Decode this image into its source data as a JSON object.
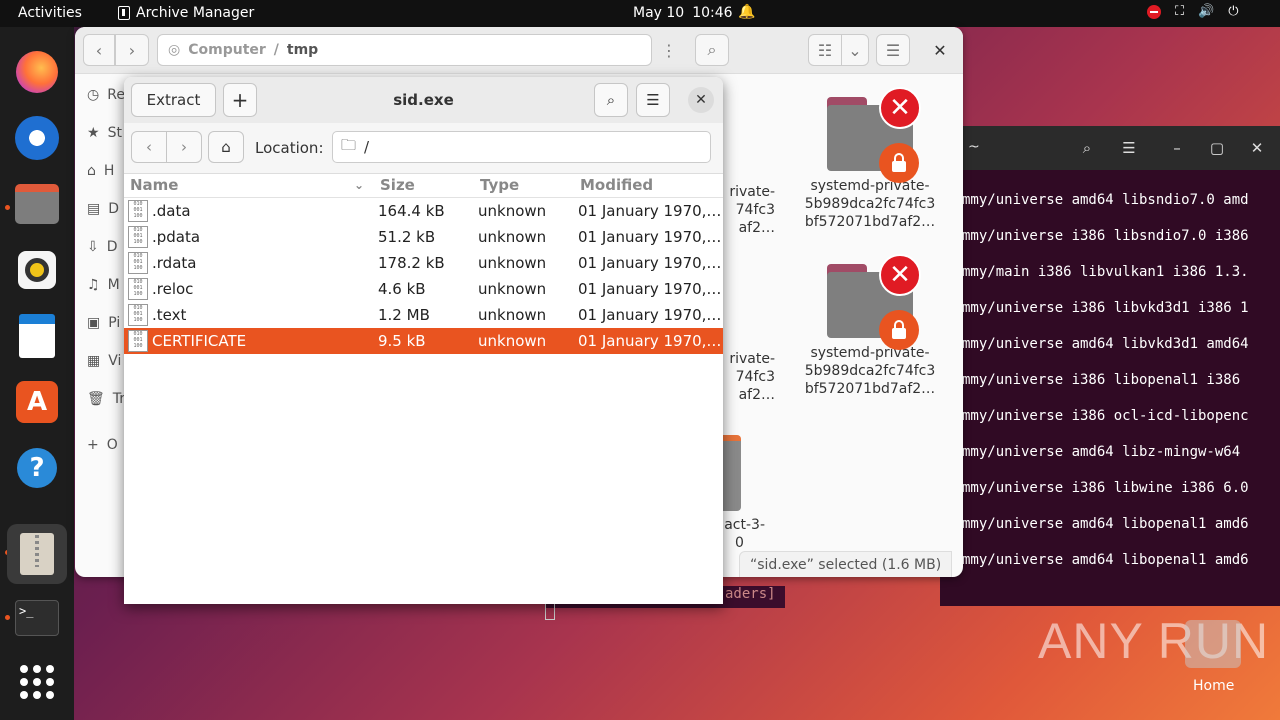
{
  "topbar": {
    "activities": "Activities",
    "app_name": "Archive Manager",
    "date": "May 10",
    "time": "10:46"
  },
  "dock": {
    "items": [
      "Firefox",
      "Thunderbird",
      "Files",
      "Rhythmbox",
      "LibreOffice Writer",
      "Ubuntu Software",
      "Help",
      "Archive Manager",
      "Terminal",
      "Show Applications"
    ]
  },
  "files_window": {
    "path_root": "Computer",
    "path_sep": "/",
    "path_current": "tmp",
    "sidebar_letters": [
      "Re",
      "St",
      "H",
      "D",
      "D",
      "M",
      "Pi",
      "Vi",
      "Tr",
      "O"
    ],
    "grid_items": [
      {
        "name_lines": [
          "systemd-private-",
          "5b989dca2fc74fc3",
          "bf572071bd7af2…"
        ]
      },
      {
        "name_lines": [
          "systemd-private-",
          "5b989dca2fc74fc3",
          "bf572071bd7af2…"
        ]
      }
    ],
    "partial_left": [
      {
        "lines": [
          "rivate-",
          "74fc3",
          "af2…"
        ]
      },
      {
        "lines": [
          "rivate-",
          "74fc3",
          "af2…"
        ]
      },
      {
        "lines": [
          "act-3-",
          "0"
        ]
      }
    ],
    "status": "“sid.exe” selected  (1.6 MB)"
  },
  "terminal": {
    "title": "~",
    "lines": [
      "mmy/universe amd64 libsndio7.0 amd",
      "mmy/universe i386 libsndio7.0 i386",
      "mmy/main i386 libvulkan1 i386 1.3.",
      "mmy/universe i386 libvkd3d1 i386 1",
      "mmy/universe amd64 libvkd3d1 amd64",
      "mmy/universe i386 libopenal1 i386",
      "mmy/universe i386 ocl-icd-libopenc",
      "mmy/universe amd64 libz-mingw-w64",
      "mmy/universe i386 libwine i386 6.0",
      "mmy/universe amd64 libopenal1 amd6",
      "mmy/universe amd64 libopenal1 amd6"
    ],
    "tail": "aders]"
  },
  "archive": {
    "extract_label": "Extract",
    "add_label": "+",
    "title": "sid.exe",
    "location_label": "Location:",
    "location_value": "/",
    "columns": {
      "name": "Name",
      "size": "Size",
      "type": "Type",
      "modified": "Modified"
    },
    "files": [
      {
        "name": ".data",
        "size": "164.4 kB",
        "type": "unknown",
        "modified": "01 January 1970,…",
        "selected": false
      },
      {
        "name": ".pdata",
        "size": "51.2 kB",
        "type": "unknown",
        "modified": "01 January 1970,…",
        "selected": false
      },
      {
        "name": ".rdata",
        "size": "178.2 kB",
        "type": "unknown",
        "modified": "01 January 1970,…",
        "selected": false
      },
      {
        "name": ".reloc",
        "size": "4.6 kB",
        "type": "unknown",
        "modified": "01 January 1970,…",
        "selected": false
      },
      {
        "name": ".text",
        "size": "1.2 MB",
        "type": "unknown",
        "modified": "01 January 1970,…",
        "selected": false
      },
      {
        "name": "CERTIFICATE",
        "size": "9.5 kB",
        "type": "unknown",
        "modified": "01 January 1970,…",
        "selected": true
      }
    ]
  },
  "desktop": {
    "watermark": "ANY RUN",
    "home_label": "Home"
  },
  "colors": {
    "accent": "#e95420",
    "topbar": "#111111",
    "dock": "#1d1d1d"
  }
}
